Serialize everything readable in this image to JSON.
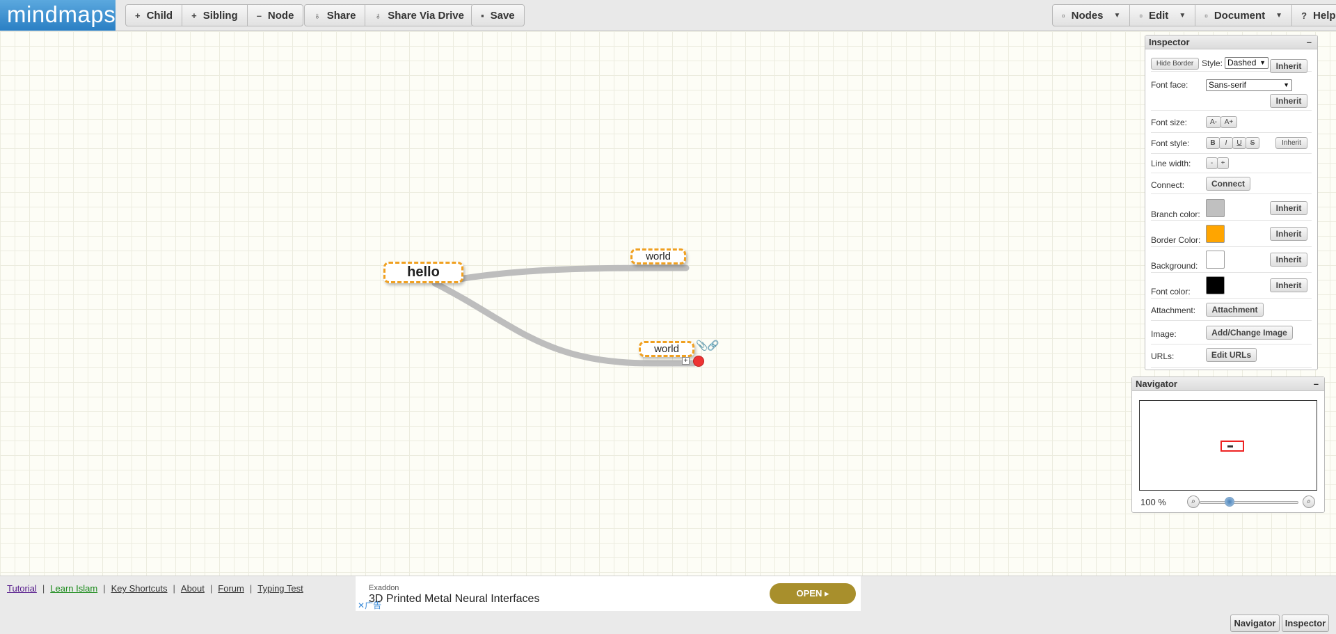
{
  "app": {
    "logo": "mindmaps"
  },
  "toolbar": {
    "child": "Child",
    "sibling": "Sibling",
    "node": "Node",
    "share": "Share",
    "share_drive": "Share Via Drive",
    "save": "Save",
    "menu_nodes": "Nodes",
    "menu_edit": "Edit",
    "menu_document": "Document",
    "help": "Help"
  },
  "mindmap": {
    "root": "hello",
    "children": [
      "world",
      "world"
    ],
    "branch_color": "#bdbdbd",
    "border_color": "#f0a020"
  },
  "inspector": {
    "title": "Inspector",
    "hide_border": "Hide Border",
    "style_label": "Style:",
    "style_value": "Dashed",
    "inherit": "Inherit",
    "font_face_label": "Font face:",
    "font_face_value": "Sans-serif",
    "font_size_label": "Font size:",
    "font_size_dec": "A-",
    "font_size_inc": "A+",
    "font_style_label": "Font style:",
    "bold": "B",
    "italic": "I",
    "underline": "U",
    "strike": "S",
    "line_width_label": "Line width:",
    "line_dec": "-",
    "line_inc": "+",
    "connect_label": "Connect:",
    "connect": "Connect",
    "branch_color_label": "Branch color:",
    "border_color_label": "Border Color:",
    "background_label": "Background:",
    "font_color_label": "Font color:",
    "attachment_label": "Attachment:",
    "attachment": "Attachment",
    "image_label": "Image:",
    "image": "Add/Change Image",
    "urls_label": "URLs:",
    "urls": "Edit URLs",
    "colors": {
      "branch": "#c0c0c0",
      "border": "#ffa500",
      "background": "#ffffff",
      "font": "#000000"
    }
  },
  "navigator": {
    "title": "Navigator",
    "zoom": "100 %"
  },
  "footer": {
    "links": [
      "Tutorial",
      "Learn Islam",
      "Key Shortcuts",
      "About",
      "Forum",
      "Typing Test"
    ],
    "ad_brand": "Exaddon",
    "ad_title": "3D Printed Metal Neural Interfaces",
    "ad_cta": "OPEN",
    "ad_close": "广告",
    "navigator_btn": "Navigator",
    "inspector_btn": "Inspector"
  }
}
